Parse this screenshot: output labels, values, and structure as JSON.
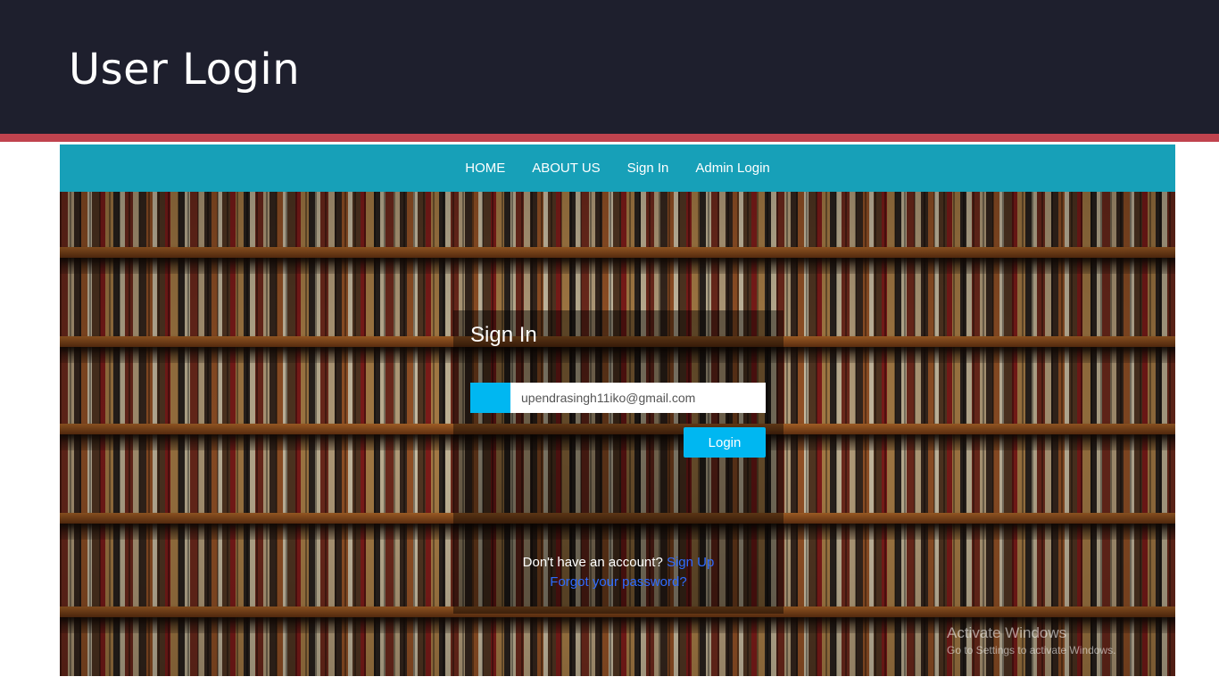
{
  "slide": {
    "title": "User Login"
  },
  "navbar": {
    "items": [
      {
        "label": "HOME"
      },
      {
        "label": "ABOUT US"
      },
      {
        "label": "Sign In"
      },
      {
        "label": "Admin Login"
      }
    ]
  },
  "signin": {
    "title": "Sign In",
    "email_value": "upendrasingh11iko@gmail.com",
    "login_label": "Login",
    "no_account_text": "Don't have an account?",
    "signup_link": "Sign Up",
    "forgot_link": "Forgot your password?"
  },
  "watermark": {
    "title": "Activate Windows",
    "subtitle": "Go to Settings to activate Windows."
  },
  "colors": {
    "header_bg": "#1e1f2d",
    "accent": "#c0434e",
    "navbar": "#17a0b8",
    "button": "#00b7f1",
    "link": "#2f6bff"
  }
}
